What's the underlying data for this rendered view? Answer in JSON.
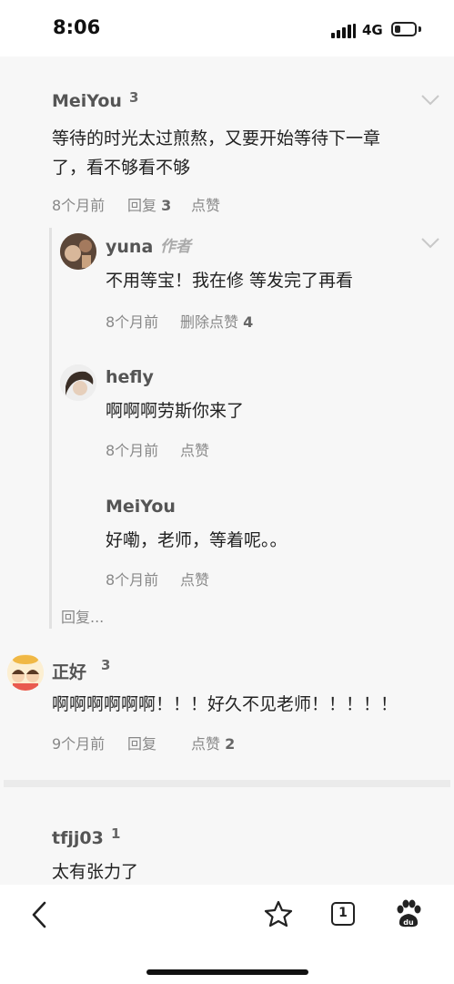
{
  "status_bar": {
    "time": "8:06",
    "network": "4G",
    "battery_level": 0.3
  },
  "comments": [
    {
      "user": "MeiYou",
      "count": "3",
      "text_line1": "等待的时光太过煎熬，又要开始等待下一章",
      "text_line2": "了，看不够看不够",
      "time": "8个月前",
      "reply_label": "回复",
      "reply_count": "3",
      "like_label": "点赞"
    },
    {
      "user": "正好",
      "count": "3",
      "text": "啊啊啊啊啊啊！！！好久不见老师！！！！！",
      "time": "9个月前",
      "reply_label": "回复",
      "like_label": "点赞",
      "like_count": "2"
    },
    {
      "user": "tfjj03",
      "count": "1",
      "text": "太有张力了"
    }
  ],
  "replies": [
    {
      "user": "yuna",
      "tag": "作者",
      "text": "不用等宝！我在修 等发完了再看",
      "time": "8个月前",
      "action": "删除点赞",
      "action_count": "4"
    },
    {
      "user": "hefly",
      "text": "啊啊啊劳斯你来了",
      "time": "8个月前",
      "like_label": "点赞"
    },
    {
      "user": "MeiYou",
      "text": "好嘞，老师，等着呢。。",
      "time": "8个月前",
      "like_label": "点赞"
    }
  ],
  "more_replies": "回复...",
  "bottom_bar": {
    "tab_count": "1",
    "icons": [
      "back-arrow-icon",
      "star-icon",
      "tabs-icon",
      "baidu-paw-icon"
    ]
  }
}
